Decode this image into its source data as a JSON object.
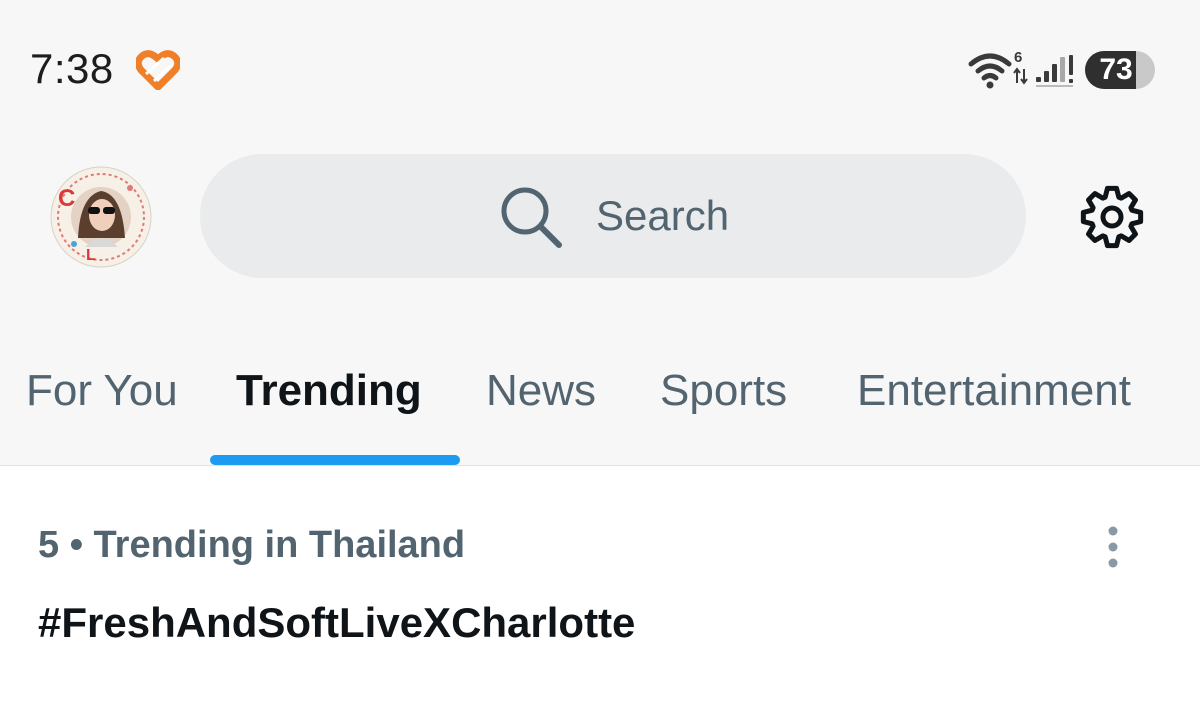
{
  "status_bar": {
    "time": "7:38",
    "wifi_badge": "6",
    "battery_percent": 73,
    "battery_label": "73",
    "icons": [
      "heart-icon",
      "wifi-icon",
      "signal-icon",
      "battery-icon"
    ]
  },
  "header": {
    "avatar_icon": "avatar",
    "search": {
      "placeholder": "Search",
      "icon": "search-icon"
    },
    "settings_icon": "gear-icon"
  },
  "tabs": [
    {
      "label": "For You",
      "active": false
    },
    {
      "label": "Trending",
      "active": true
    },
    {
      "label": "News",
      "active": false
    },
    {
      "label": "Sports",
      "active": false
    },
    {
      "label": "Entertainment",
      "active": false
    }
  ],
  "trends": [
    {
      "meta": "5 • Trending in Thailand",
      "name": "#FreshAndSoftLiveXCharlotte",
      "more_icon": "more-vertical-icon"
    }
  ],
  "colors": {
    "accent": "#1d9bf0",
    "primary_text": "#0f1419",
    "secondary_text": "#536471",
    "search_bg": "#e9ebec",
    "heart": "#f07f2a"
  }
}
